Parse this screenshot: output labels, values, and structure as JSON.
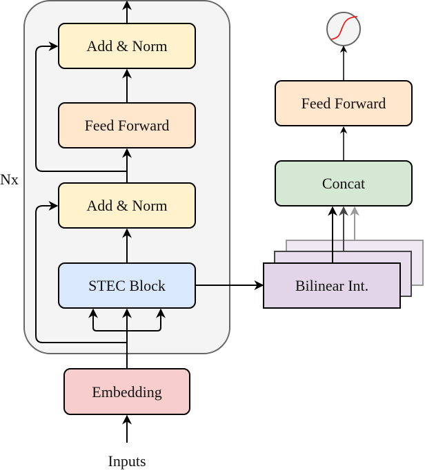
{
  "encoder": {
    "repeat_label": "Nx",
    "add_norm_top": "Add & Norm",
    "feed_forward": "Feed Forward",
    "add_norm_bottom": "Add & Norm",
    "stec_block": "STEC Block"
  },
  "embedding": "Embedding",
  "inputs": "Inputs",
  "head": {
    "bilinear": "Bilinear Int.",
    "concat": "Concat",
    "feed_forward": "Feed Forward",
    "activation_icon": "sigmoid-icon"
  },
  "colors": {
    "container_fill": "#f4f4f4",
    "container_stroke": "#666666",
    "add_norm": "#fff2cc",
    "feed_forward": "#ffe6cc",
    "stec": "#dae8fc",
    "embedding": "#f8cecc",
    "concat": "#d5e8d4",
    "bilinear": "#e1d5e7",
    "sigmoid_curve": "#ff0000"
  }
}
